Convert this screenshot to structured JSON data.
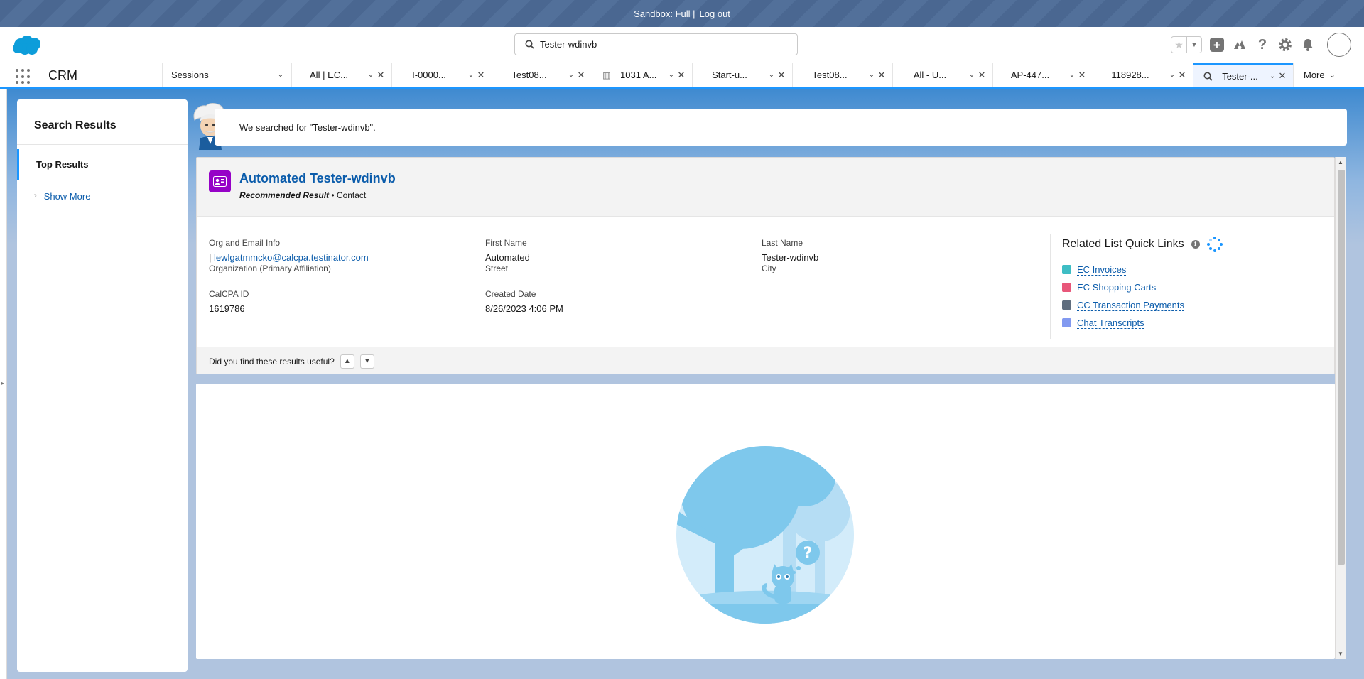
{
  "sandbox": {
    "text": "Sandbox: Full |",
    "logout": "Log out"
  },
  "header": {
    "search_value": "Tester-wdinvb",
    "icons": [
      "favorites-star-icon",
      "favorites-dropdown-icon",
      "global-actions-add-icon",
      "trailhead-icon",
      "help-icon",
      "setup-gear-icon",
      "notifications-bell-icon",
      "avatar"
    ]
  },
  "nav": {
    "app_name": "CRM",
    "tabs": [
      {
        "label": "Sessions",
        "closable": false
      },
      {
        "label": "All | EC...",
        "closable": true
      },
      {
        "label": "I-0000...",
        "closable": true
      },
      {
        "label": "Test08...",
        "closable": true
      },
      {
        "label": "1031 A...",
        "closable": true,
        "icon": "building-icon"
      },
      {
        "label": "Start-u...",
        "closable": true
      },
      {
        "label": "Test08...",
        "closable": true
      },
      {
        "label": "All - U...",
        "closable": true
      },
      {
        "label": "AP-447...",
        "closable": true
      },
      {
        "label": "118928...",
        "closable": true
      },
      {
        "label": "Tester-...",
        "closable": true,
        "icon": "search-icon",
        "active": true
      }
    ],
    "more": "More"
  },
  "sidebar": {
    "title": "Search Results",
    "top_results": "Top Results",
    "show_more": "Show More"
  },
  "banner": {
    "text": "We searched for \"Tester-wdinvb\"."
  },
  "card": {
    "title": "Automated Tester-wdinvb",
    "recommended": "Recommended Result",
    "separator": " • ",
    "object_type": "Contact",
    "fields": [
      {
        "label": "Org and Email Info",
        "value": "| lewlgatmmcko@calcpa.testinator.com",
        "link": "lewlgatmmcko@calcpa.testinator.com"
      },
      {
        "label": "First Name",
        "value": "Automated"
      },
      {
        "label": "Last Name",
        "value": "Tester-wdinvb"
      },
      {
        "label": "Organization (Primary Affiliation)",
        "value": ""
      },
      {
        "label": "Street",
        "value": ""
      },
      {
        "label": "City",
        "value": ""
      },
      {
        "label": "CalCPA ID",
        "value": "1619786"
      },
      {
        "label": "Created Date",
        "value": "8/26/2023 4:06 PM"
      }
    ],
    "quick_links": {
      "title": "Related List Quick Links",
      "items": [
        {
          "label": "EC Invoices",
          "color": "#3ebdc4"
        },
        {
          "label": "EC Shopping Carts",
          "color": "#e8577a"
        },
        {
          "label": "CC Transaction Payments",
          "color": "#5f6d7e"
        },
        {
          "label": "Chat Transcripts",
          "color": "#8299f0"
        }
      ]
    },
    "feedback": "Did you find these results useful?"
  },
  "colors": {
    "brand": "#1b96ff",
    "link": "#0b5cab",
    "contact": "#9602c7",
    "illustration": "#7ec8ec"
  }
}
